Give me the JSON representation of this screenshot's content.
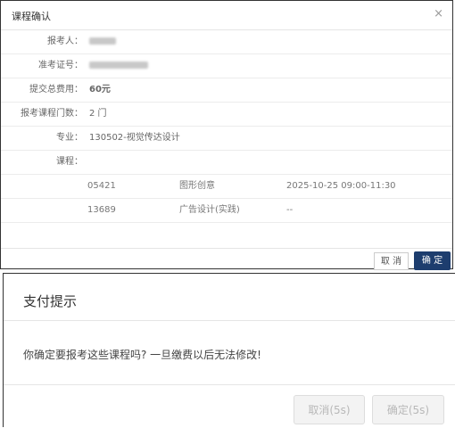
{
  "confirm_dialog": {
    "title": "课程确认",
    "close_symbol": "×",
    "fields": {
      "applicant_label": "报考人：",
      "ticket_label": "准考证号：",
      "fee_label": "提交总费用：",
      "fee_value": "60元",
      "course_count_label": "报考课程门数：",
      "course_count_value": "2 门",
      "major_label": "专业：",
      "major_value": "130502-视觉传达设计",
      "courses_label": "课程："
    },
    "courses": [
      {
        "code": "05421",
        "name": "图形创意",
        "time": "2025-10-25 09:00-11:30"
      },
      {
        "code": "13689",
        "name": "广告设计(实践)",
        "time": "--"
      }
    ],
    "cancel_label": "取 消",
    "ok_label": "确 定"
  },
  "payment_dialog": {
    "title": "支付提示",
    "message": "你确定要报考这些课程吗? 一旦缴费以后无法修改!",
    "cancel_label": "取消(5s)",
    "ok_label": "确定(5s)"
  }
}
